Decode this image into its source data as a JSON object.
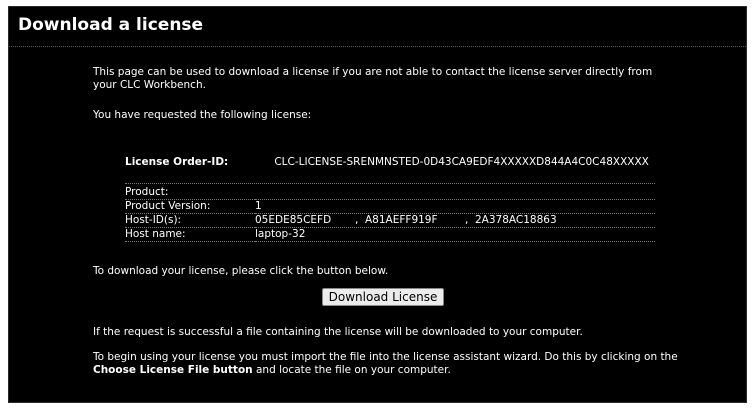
{
  "page": {
    "title": "Download a license"
  },
  "text": {
    "intro": "This page can be used to download a license if you are not able to contact the license server directly from your CLC Workbench.",
    "requested": "You have requested the following license:",
    "click_instruction": "To download your license, please click the button below.",
    "success": "If the request is successful a file containing the license will be downloaded to your computer.",
    "begin_part1": "To begin using your license you must import the file into the license assistant wizard. Do this by clicking on the",
    "begin_bold": "Choose License File button",
    "begin_part2": "and locate the file on your computer."
  },
  "license": {
    "order_label": "License Order-ID:",
    "order_id": "CLC-LICENSE-SRENMNSTED-0D43CA9EDF4XXXXXD844A4C0C48XXXXX",
    "product_label": "Product:",
    "product_value": "",
    "version_label": "Product Version:",
    "version_value": "1",
    "host_id_label": "Host-ID(s):",
    "host_ids": [
      "05EDE85CEFD",
      "A81AEFF919F",
      "2A378AC18863"
    ],
    "host_name_label": "Host name:",
    "host_name_value": "laptop-32"
  },
  "button": {
    "download_label": "Download License"
  }
}
